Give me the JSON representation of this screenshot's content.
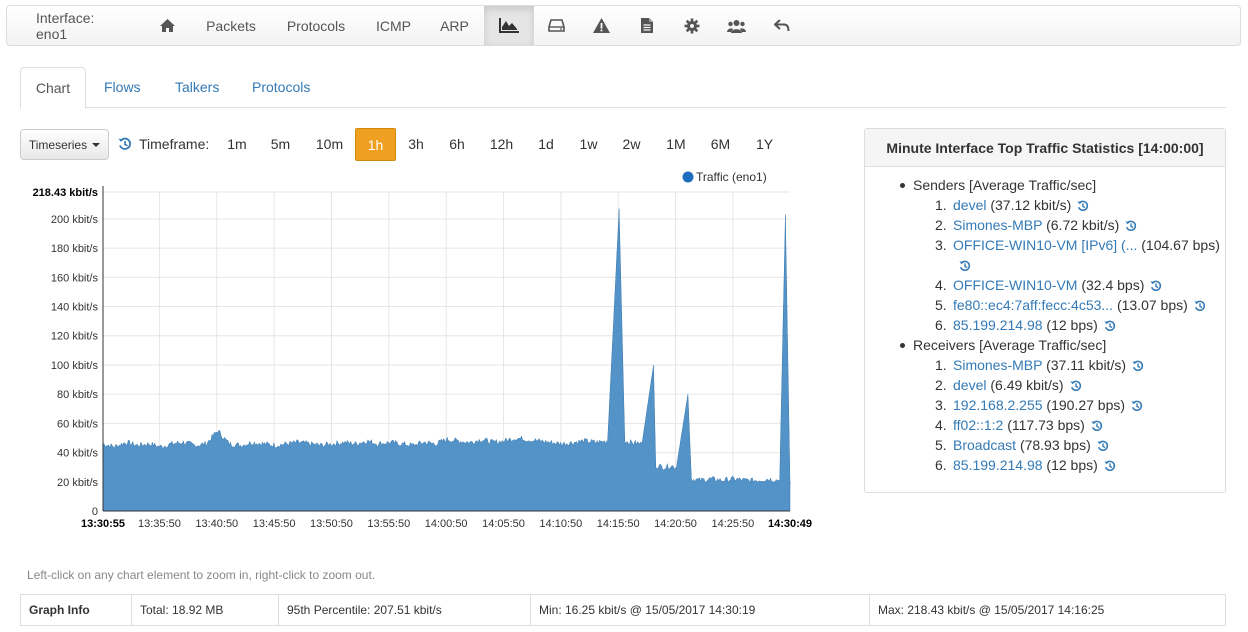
{
  "navbar": {
    "interface_label": "Interface: eno1",
    "items": [
      {
        "type": "icon",
        "icon": "home-icon"
      },
      {
        "type": "text",
        "label": "Packets"
      },
      {
        "type": "text",
        "label": "Protocols"
      },
      {
        "type": "text",
        "label": "ICMP"
      },
      {
        "type": "text",
        "label": "ARP"
      },
      {
        "type": "icon",
        "icon": "area-chart-icon",
        "active": true
      },
      {
        "type": "icon",
        "icon": "hard-drive-icon"
      },
      {
        "type": "icon",
        "icon": "warning-icon"
      },
      {
        "type": "icon",
        "icon": "document-icon"
      },
      {
        "type": "icon",
        "icon": "gear-icon"
      },
      {
        "type": "icon",
        "icon": "users-icon"
      },
      {
        "type": "icon",
        "icon": "reply-icon"
      }
    ]
  },
  "tabs": [
    {
      "label": "Chart",
      "active": true
    },
    {
      "label": "Flows"
    },
    {
      "label": "Talkers"
    },
    {
      "label": "Protocols"
    }
  ],
  "toolbar": {
    "timeseries_label": "Timeseries",
    "timeframe_label": "Timeframe:",
    "timeframes": [
      "1m",
      "5m",
      "10m",
      "1h",
      "3h",
      "6h",
      "12h",
      "1d",
      "1w",
      "2w",
      "1M",
      "6M",
      "1Y"
    ],
    "active_timeframe": "1h",
    "accent": "#f0a020"
  },
  "chart_data": {
    "type": "area",
    "title": "",
    "xlabel": "",
    "ylabel": "",
    "series": [
      {
        "name": "Traffic (eno1)",
        "color": "#4a8dc5"
      }
    ],
    "y_unit": "kbit/s",
    "y_ticks": [
      "0",
      "20 kbit/s",
      "40 kbit/s",
      "60 kbit/s",
      "80 kbit/s",
      "100 kbit/s",
      "120 kbit/s",
      "140 kbit/s",
      "160 kbit/s",
      "180 kbit/s",
      "200 kbit/s",
      "218.43 kbit/s"
    ],
    "y_tick_values": [
      0,
      20,
      40,
      60,
      80,
      100,
      120,
      140,
      160,
      180,
      200,
      218.43
    ],
    "ylim": [
      0,
      218.43
    ],
    "x_ticks": [
      "13:30:55",
      "13:35:50",
      "13:40:50",
      "13:45:50",
      "13:50:50",
      "13:55:50",
      "14:00:50",
      "14:05:50",
      "14:10:50",
      "14:15:50",
      "14:20:50",
      "14:25:50",
      "14:30:49"
    ],
    "x_tick_minutes": [
      0,
      4.92,
      9.92,
      14.92,
      19.92,
      24.92,
      29.92,
      34.92,
      39.92,
      44.92,
      49.92,
      54.92,
      59.9
    ],
    "xlim_minutes": [
      0,
      59.9
    ],
    "grid": true,
    "legend_position": "top-right",
    "points_minutes": [
      0,
      1,
      2,
      3,
      4,
      5,
      6,
      7,
      8,
      9,
      10,
      11,
      12,
      13,
      14,
      15,
      16,
      17,
      18,
      19,
      20,
      21,
      22,
      23,
      24,
      25,
      26,
      27,
      28,
      29,
      30,
      31,
      32,
      33,
      34,
      35,
      36,
      37,
      38,
      39,
      40,
      41,
      42,
      43,
      44,
      45,
      45.5,
      46,
      47,
      48,
      48.2,
      49,
      49.5,
      50,
      51,
      51.3,
      52,
      53,
      54,
      55,
      56,
      57,
      58,
      59,
      59.5,
      59.9
    ],
    "values": [
      46,
      44,
      47,
      45,
      46,
      44,
      46,
      47,
      45,
      46,
      55,
      46,
      45,
      47,
      46,
      45,
      46,
      47,
      46,
      45,
      46,
      47,
      46,
      48,
      46,
      47,
      46,
      45,
      47,
      46,
      49,
      48,
      47,
      49,
      47,
      48,
      50,
      49,
      48,
      47,
      46,
      47,
      48,
      47,
      48,
      207,
      48,
      47,
      46,
      100,
      31,
      30,
      31,
      30,
      80,
      22,
      21,
      22,
      21,
      22,
      21,
      21,
      22,
      21,
      203,
      20
    ]
  },
  "stats": {
    "title": "Minute Interface Top Traffic Statistics [14:00:00]",
    "senders_title": "Senders [Average Traffic/sec]",
    "senders": [
      {
        "num": "1.",
        "name": "devel",
        "value": "(37.12 kbit/s)"
      },
      {
        "num": "2.",
        "name": "Simones-MBP",
        "value": "(6.72 kbit/s)"
      },
      {
        "num": "3.",
        "name": "OFFICE-WIN10-VM [IPv6] (...",
        "value": "(104.67 bps)"
      },
      {
        "num": "4.",
        "name": "OFFICE-WIN10-VM",
        "value": "(32.4 bps)"
      },
      {
        "num": "5.",
        "name": "fe80::ec4:7aff:fecc:4c53...",
        "value": "(13.07 bps)"
      },
      {
        "num": "6.",
        "name": "85.199.214.98",
        "value": "(12 bps)"
      }
    ],
    "receivers_title": "Receivers [Average Traffic/sec]",
    "receivers": [
      {
        "num": "1.",
        "name": "Simones-MBP",
        "value": "(37.11 kbit/s)"
      },
      {
        "num": "2.",
        "name": "devel",
        "value": "(6.49 kbit/s)"
      },
      {
        "num": "3.",
        "name": "192.168.2.255",
        "value": "(190.27 bps)"
      },
      {
        "num": "4.",
        "name": "ff02::1:2",
        "value": "(117.73 bps)"
      },
      {
        "num": "5.",
        "name": "Broadcast",
        "value": "(78.93 bps)"
      },
      {
        "num": "6.",
        "name": "85.199.214.98",
        "value": "(12 bps)"
      }
    ]
  },
  "hint": "Left-click on any chart element to zoom in, right-click to zoom out.",
  "graph_info": {
    "title": "Graph Info",
    "total": "Total: 18.92 MB",
    "percentile": "95th Percentile: 207.51 kbit/s",
    "min": "Min: 16.25 kbit/s @ 15/05/2017 14:30:19",
    "max": "Max: 218.43 kbit/s @ 15/05/2017 14:16:25"
  }
}
